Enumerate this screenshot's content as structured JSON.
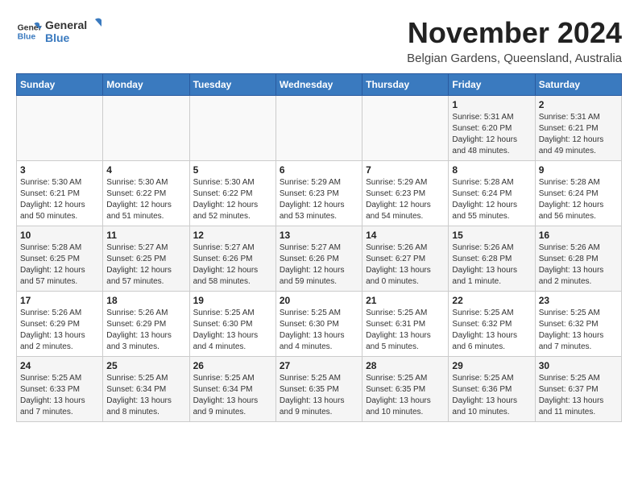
{
  "header": {
    "logo_line1": "General",
    "logo_line2": "Blue",
    "month": "November 2024",
    "location": "Belgian Gardens, Queensland, Australia"
  },
  "weekdays": [
    "Sunday",
    "Monday",
    "Tuesday",
    "Wednesday",
    "Thursday",
    "Friday",
    "Saturday"
  ],
  "weeks": [
    [
      {
        "day": "",
        "info": ""
      },
      {
        "day": "",
        "info": ""
      },
      {
        "day": "",
        "info": ""
      },
      {
        "day": "",
        "info": ""
      },
      {
        "day": "",
        "info": ""
      },
      {
        "day": "1",
        "info": "Sunrise: 5:31 AM\nSunset: 6:20 PM\nDaylight: 12 hours and 48 minutes."
      },
      {
        "day": "2",
        "info": "Sunrise: 5:31 AM\nSunset: 6:21 PM\nDaylight: 12 hours and 49 minutes."
      }
    ],
    [
      {
        "day": "3",
        "info": "Sunrise: 5:30 AM\nSunset: 6:21 PM\nDaylight: 12 hours and 50 minutes."
      },
      {
        "day": "4",
        "info": "Sunrise: 5:30 AM\nSunset: 6:22 PM\nDaylight: 12 hours and 51 minutes."
      },
      {
        "day": "5",
        "info": "Sunrise: 5:30 AM\nSunset: 6:22 PM\nDaylight: 12 hours and 52 minutes."
      },
      {
        "day": "6",
        "info": "Sunrise: 5:29 AM\nSunset: 6:23 PM\nDaylight: 12 hours and 53 minutes."
      },
      {
        "day": "7",
        "info": "Sunrise: 5:29 AM\nSunset: 6:23 PM\nDaylight: 12 hours and 54 minutes."
      },
      {
        "day": "8",
        "info": "Sunrise: 5:28 AM\nSunset: 6:24 PM\nDaylight: 12 hours and 55 minutes."
      },
      {
        "day": "9",
        "info": "Sunrise: 5:28 AM\nSunset: 6:24 PM\nDaylight: 12 hours and 56 minutes."
      }
    ],
    [
      {
        "day": "10",
        "info": "Sunrise: 5:28 AM\nSunset: 6:25 PM\nDaylight: 12 hours and 57 minutes."
      },
      {
        "day": "11",
        "info": "Sunrise: 5:27 AM\nSunset: 6:25 PM\nDaylight: 12 hours and 57 minutes."
      },
      {
        "day": "12",
        "info": "Sunrise: 5:27 AM\nSunset: 6:26 PM\nDaylight: 12 hours and 58 minutes."
      },
      {
        "day": "13",
        "info": "Sunrise: 5:27 AM\nSunset: 6:26 PM\nDaylight: 12 hours and 59 minutes."
      },
      {
        "day": "14",
        "info": "Sunrise: 5:26 AM\nSunset: 6:27 PM\nDaylight: 13 hours and 0 minutes."
      },
      {
        "day": "15",
        "info": "Sunrise: 5:26 AM\nSunset: 6:28 PM\nDaylight: 13 hours and 1 minute."
      },
      {
        "day": "16",
        "info": "Sunrise: 5:26 AM\nSunset: 6:28 PM\nDaylight: 13 hours and 2 minutes."
      }
    ],
    [
      {
        "day": "17",
        "info": "Sunrise: 5:26 AM\nSunset: 6:29 PM\nDaylight: 13 hours and 2 minutes."
      },
      {
        "day": "18",
        "info": "Sunrise: 5:26 AM\nSunset: 6:29 PM\nDaylight: 13 hours and 3 minutes."
      },
      {
        "day": "19",
        "info": "Sunrise: 5:25 AM\nSunset: 6:30 PM\nDaylight: 13 hours and 4 minutes."
      },
      {
        "day": "20",
        "info": "Sunrise: 5:25 AM\nSunset: 6:30 PM\nDaylight: 13 hours and 4 minutes."
      },
      {
        "day": "21",
        "info": "Sunrise: 5:25 AM\nSunset: 6:31 PM\nDaylight: 13 hours and 5 minutes."
      },
      {
        "day": "22",
        "info": "Sunrise: 5:25 AM\nSunset: 6:32 PM\nDaylight: 13 hours and 6 minutes."
      },
      {
        "day": "23",
        "info": "Sunrise: 5:25 AM\nSunset: 6:32 PM\nDaylight: 13 hours and 7 minutes."
      }
    ],
    [
      {
        "day": "24",
        "info": "Sunrise: 5:25 AM\nSunset: 6:33 PM\nDaylight: 13 hours and 7 minutes."
      },
      {
        "day": "25",
        "info": "Sunrise: 5:25 AM\nSunset: 6:34 PM\nDaylight: 13 hours and 8 minutes."
      },
      {
        "day": "26",
        "info": "Sunrise: 5:25 AM\nSunset: 6:34 PM\nDaylight: 13 hours and 9 minutes."
      },
      {
        "day": "27",
        "info": "Sunrise: 5:25 AM\nSunset: 6:35 PM\nDaylight: 13 hours and 9 minutes."
      },
      {
        "day": "28",
        "info": "Sunrise: 5:25 AM\nSunset: 6:35 PM\nDaylight: 13 hours and 10 minutes."
      },
      {
        "day": "29",
        "info": "Sunrise: 5:25 AM\nSunset: 6:36 PM\nDaylight: 13 hours and 10 minutes."
      },
      {
        "day": "30",
        "info": "Sunrise: 5:25 AM\nSunset: 6:37 PM\nDaylight: 13 hours and 11 minutes."
      }
    ]
  ]
}
